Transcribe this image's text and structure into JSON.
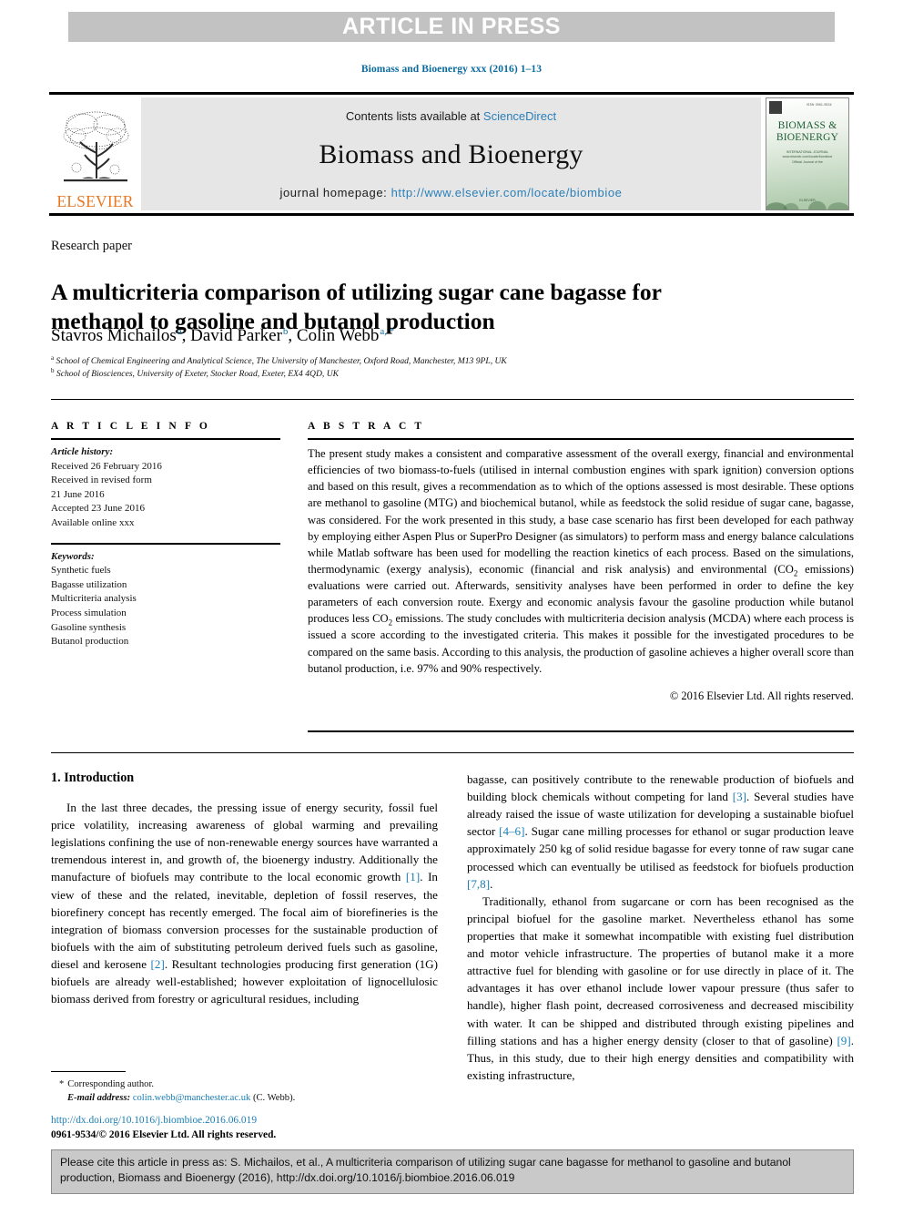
{
  "banner": {
    "label": "ARTICLE IN PRESS"
  },
  "running_head": "Biomass and Bioenergy xxx (2016) 1–13",
  "masthead": {
    "publisher_name": "ELSEVIER",
    "contents_prefix": "Contents lists available at ",
    "contents_link": "ScienceDirect",
    "journal_title": "Biomass and Bioenergy",
    "homepage_prefix": "journal homepage: ",
    "homepage_link": "http://www.elsevier.com/locate/biombioe",
    "cover": {
      "issn_text": "ISSN 0961-9534",
      "title_line1": "BIOMASS &",
      "title_line2": "BIOENERGY",
      "subtitle": "INTERNATIONAL JOURNAL",
      "sub_line2": "www.elsevier.com/locate/biombioe",
      "sub_line3": "Official Journal of the",
      "footer": "ELSEVIER"
    }
  },
  "article": {
    "type": "Research paper",
    "title": "A multicriteria comparison of utilizing sugar cane bagasse for methanol to gasoline and butanol production",
    "authors": [
      {
        "name": "Stavros Michailos",
        "marks": "a"
      },
      {
        "name": "David Parker",
        "marks": "b"
      },
      {
        "name": "Colin Webb",
        "marks": "a, *"
      }
    ],
    "affiliations": [
      {
        "mark": "a",
        "text": "School of Chemical Engineering and Analytical Science, The University of Manchester, Oxford Road, Manchester, M13 9PL, UK"
      },
      {
        "mark": "b",
        "text": "School of Biosciences, University of Exeter, Stocker Road, Exeter, EX4 4QD, UK"
      }
    ]
  },
  "article_info": {
    "heading": "A R T I C L E  I N F O",
    "history_title": "Article history:",
    "history": [
      "Received 26 February 2016",
      "Received in revised form",
      "21 June 2016",
      "Accepted 23 June 2016",
      "Available online xxx"
    ],
    "keywords_title": "Keywords:",
    "keywords": [
      "Synthetic fuels",
      "Bagasse utilization",
      "Multicriteria analysis",
      "Process simulation",
      "Gasoline synthesis",
      "Butanol production"
    ]
  },
  "abstract": {
    "heading": "A B S T R A C T",
    "text_part1": "The present study makes a consistent and comparative assessment of the overall exergy, financial and environmental efficiencies of two biomass-to-fuels (utilised in internal combustion engines with spark ignition) conversion options and based on this result, gives a recommendation as to which of the options assessed is most desirable. These options are methanol to gasoline (MTG) and biochemical butanol, while as feedstock the solid residue of sugar cane, bagasse, was considered. For the work presented in this study, a base case scenario has first been developed for each pathway by employing either Aspen Plus or SuperPro Designer (as simulators) to perform mass and energy balance calculations while Matlab software has been used for modelling the reaction kinetics of each process. Based on the simulations, thermodynamic (exergy analysis), economic (financial and risk analysis) and environmental (CO",
    "sub1": "2",
    "text_part2": " emissions) evaluations were carried out. Afterwards, sensitivity analyses have been performed in order to define the key parameters of each conversion route. Exergy and economic analysis favour the gasoline production while butanol produces less CO",
    "sub2": "2",
    "text_part3": " emissions. The study concludes with multicriteria decision analysis (MCDA) where each process is issued a score according to the investigated criteria. This makes it possible for the investigated procedures to be compared on the same basis. According to this analysis, the production of gasoline achieves a higher overall score than butanol production, i.e. 97% and 90% respectively.",
    "copyright": "© 2016 Elsevier Ltd. All rights reserved."
  },
  "introduction": {
    "section_title": "1.  Introduction",
    "left_p1_a": "In the last three decades, the pressing issue of energy security, fossil fuel price volatility, increasing awareness of global warming and prevailing legislations confining the use of non-renewable energy sources have warranted a tremendous interest in, and growth of, the bioenergy industry. Additionally the manufacture of biofuels may contribute to the local economic growth ",
    "left_ref1": "[1]",
    "left_p1_b": ". In view of these and the related, inevitable, depletion of fossil reserves, the biorefinery concept has recently emerged. The focal aim of biorefineries is the integration of biomass conversion processes for the sustainable production of biofuels with the aim of substituting petroleum derived fuels such as gasoline, diesel and kerosene ",
    "left_ref2": "[2]",
    "left_p1_c": ". Resultant technologies producing first generation (1G) biofuels are already well-established; however exploitation of lignocellulosic biomass derived from forestry or agricultural residues, including",
    "right_p1_a": "bagasse, can positively contribute to the renewable production of biofuels and building block chemicals without competing for land ",
    "right_ref3": "[3]",
    "right_p1_b": ". Several studies have already raised the issue of waste utilization for developing a sustainable biofuel sector ",
    "right_ref4": "[4–6]",
    "right_p1_c": ". Sugar cane milling processes for ethanol or sugar production leave approximately 250 kg of solid residue bagasse for every tonne of raw sugar cane processed which can eventually be utilised as feedstock for biofuels production ",
    "right_ref5": "[7,8]",
    "right_p1_d": ".",
    "right_p2_a": "Traditionally, ethanol from sugarcane or corn has been recognised as the principal biofuel for the gasoline market. Nevertheless ethanol has some properties that make it somewhat incompatible with existing fuel distribution and motor vehicle infrastructure. The properties of butanol make it a more attractive fuel for blending with gasoline or for use directly in place of it. The advantages it has over ethanol include lower vapour pressure (thus safer to handle), higher flash point, decreased corrosiveness and decreased miscibility with water. It can be shipped and distributed through existing pipelines and filling stations and has a higher energy density (closer to that of gasoline) ",
    "right_ref9": "[9]",
    "right_p2_b": ". Thus, in this study, due to their high energy densities and compatibility with existing infrastructure,"
  },
  "footnote": {
    "star": "*",
    "corresponding": "Corresponding author.",
    "email_label": "E-mail address:",
    "email": "colin.webb@manchester.ac.uk",
    "email_suffix": " (C. Webb)."
  },
  "doi": {
    "link": "http://dx.doi.org/10.1016/j.biombioe.2016.06.019",
    "issn_line": "0961-9534/© 2016 Elsevier Ltd. All rights reserved."
  },
  "citation_footer": {
    "text": "Please cite this article in press as: S. Michailos, et al., A multicriteria comparison of utilizing sugar cane bagasse for methanol to gasoline and butanol production, Biomass and Bioenergy (2016), http://dx.doi.org/10.1016/j.biombioe.2016.06.019"
  },
  "colors": {
    "banner_bg": "#c2c2c2",
    "link_blue": "#1a7fb5",
    "elsevier_orange": "#e87722",
    "journal_band_bg": "#e6e6e6",
    "cite_box_bg": "#c9c9c9"
  }
}
